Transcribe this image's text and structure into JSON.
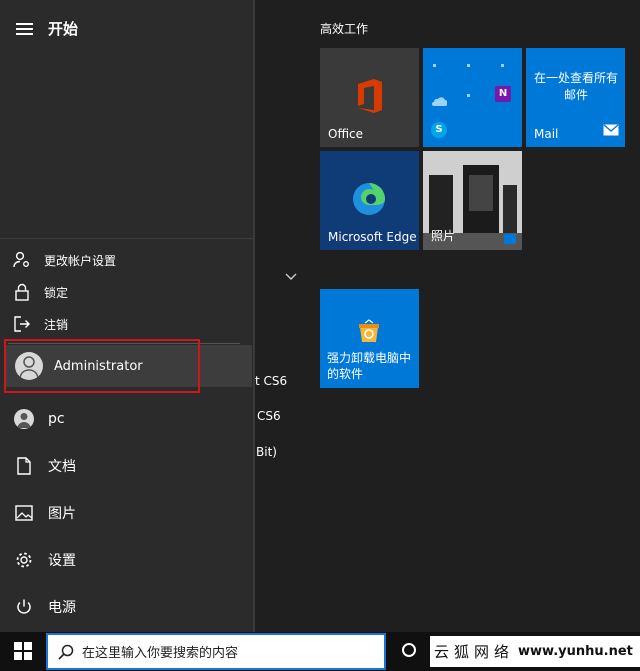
{
  "header": {
    "title": "开始"
  },
  "rail": {
    "items": [
      {
        "label": "pc"
      },
      {
        "label": "文档"
      },
      {
        "label": "图片"
      },
      {
        "label": "设置"
      },
      {
        "label": "电源"
      }
    ]
  },
  "account_menu": {
    "items": [
      {
        "label": "更改帐户设置"
      },
      {
        "label": "锁定"
      },
      {
        "label": "注销"
      }
    ],
    "current_user": "Administrator"
  },
  "app_list_fragments": [
    "t CS6",
    "CS6",
    "Bit)"
  ],
  "tiles": {
    "group_title": "高效工作",
    "office_label": "Office",
    "mail_label": "Mail",
    "mail_caption": "在一处查看所有邮件",
    "edge_label": "Microsoft Edge",
    "photos_label": "照片",
    "uninstall_label": "强力卸载电脑中的软件"
  },
  "taskbar": {
    "search_placeholder": "在这里输入你要搜索的内容"
  },
  "watermark": {
    "text": "云狐网络",
    "url": "www.yunhu.net"
  },
  "colors": {
    "tile_blue": "#0078d7",
    "office_red": "#d83b01",
    "highlight_red": "#d0151b"
  }
}
